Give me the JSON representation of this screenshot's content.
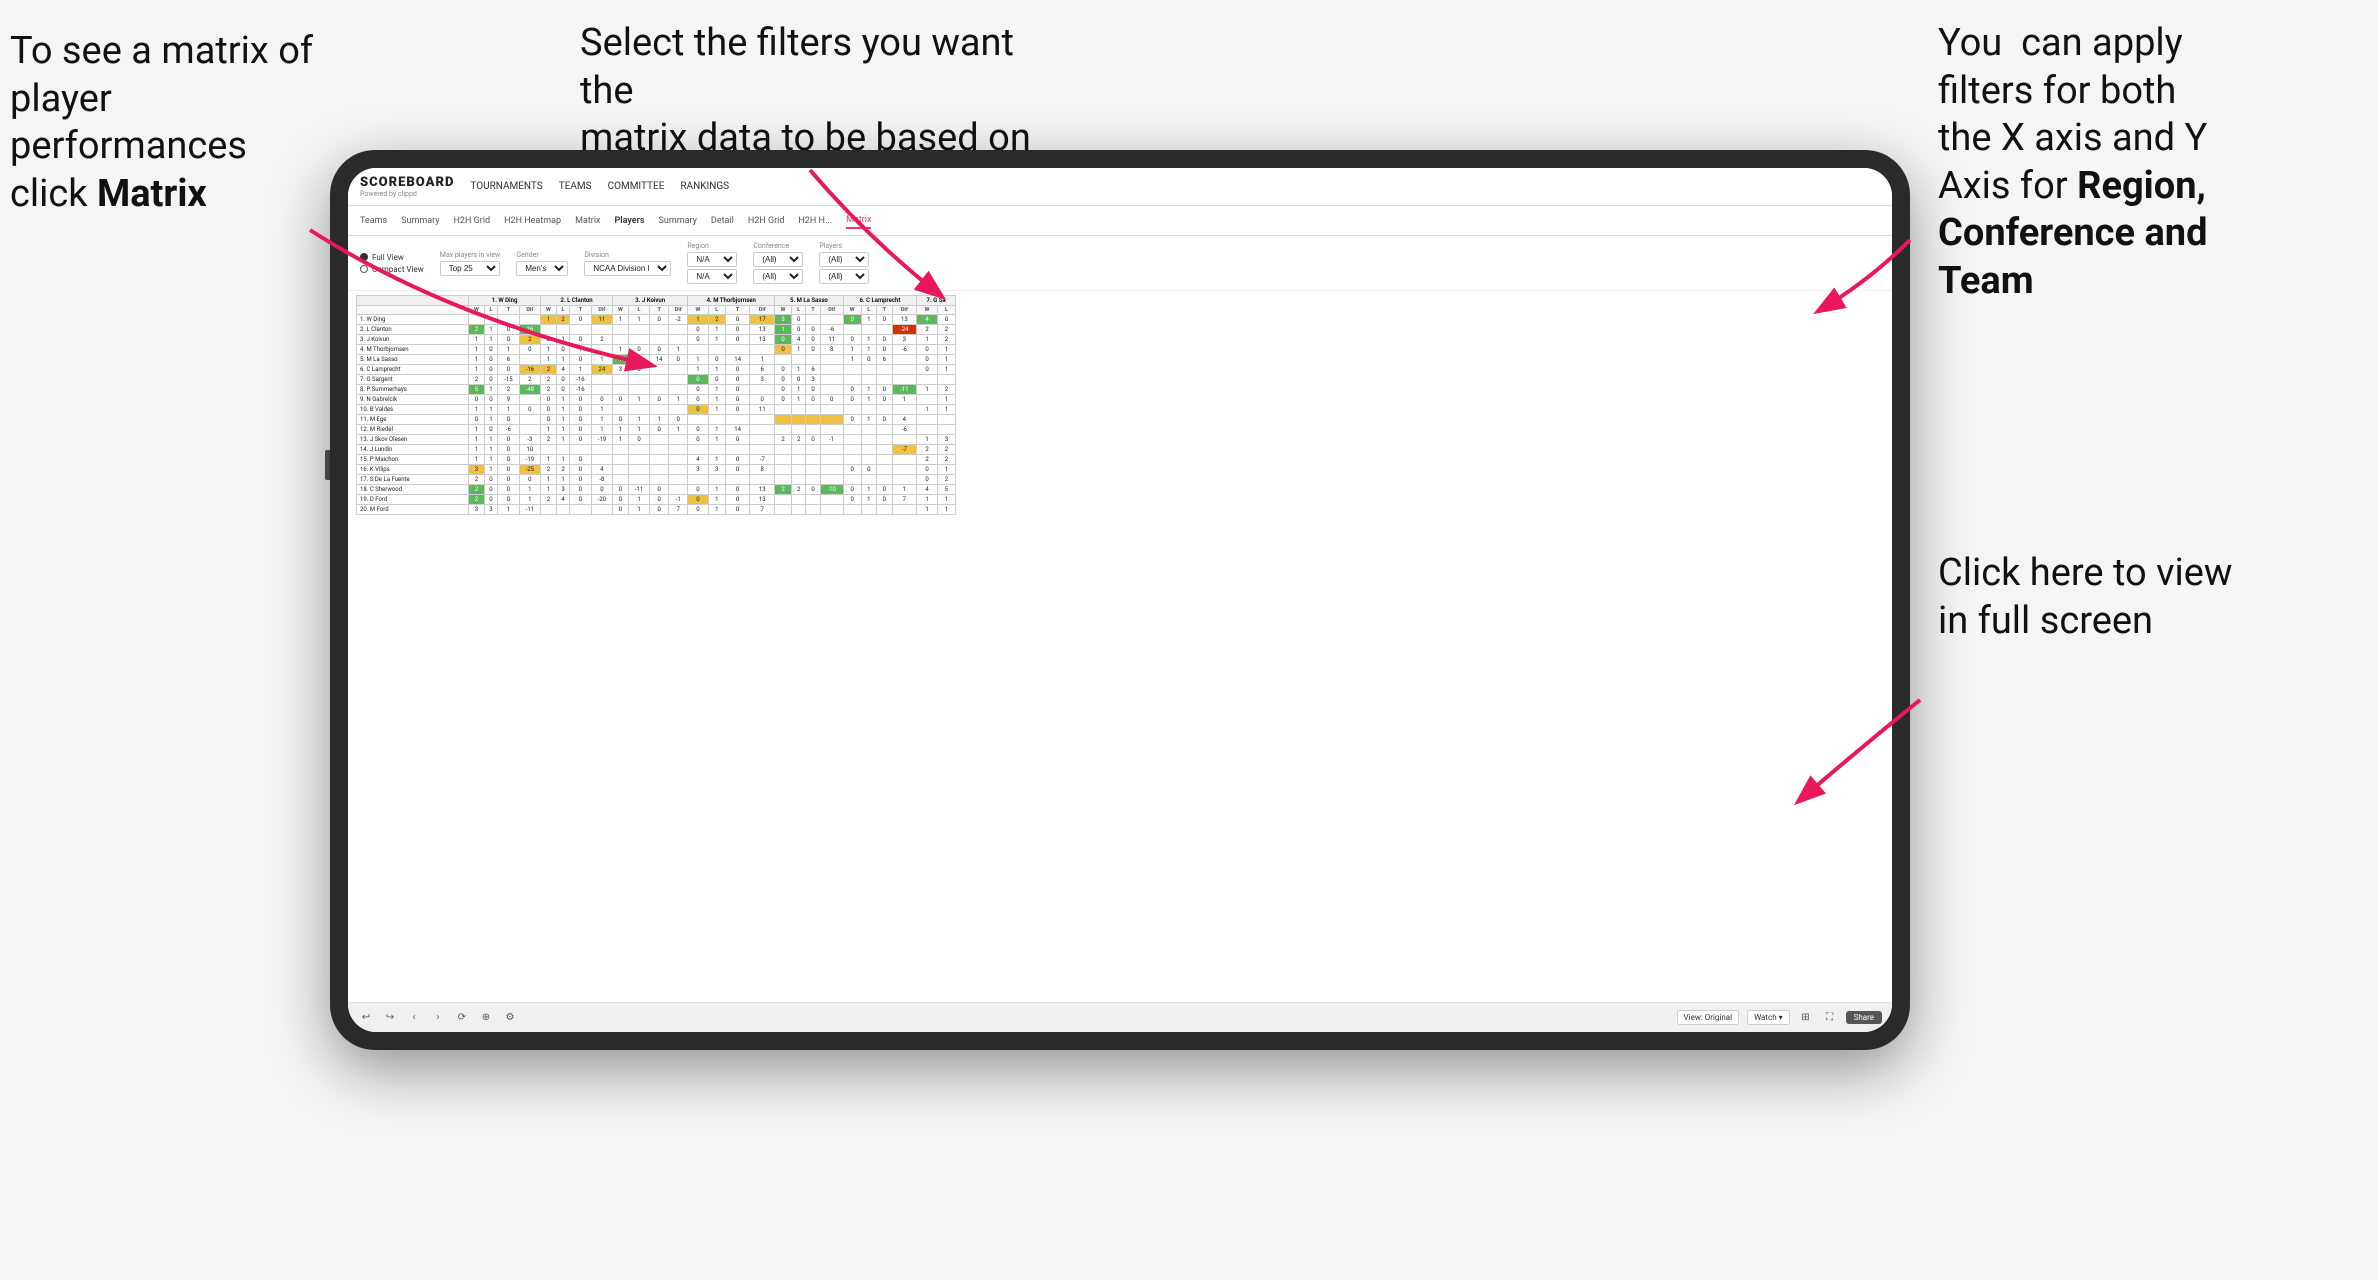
{
  "annotations": {
    "left": {
      "line1": "To see a matrix of",
      "line2": "player performances",
      "line3_pre": "click ",
      "line3_bold": "Matrix"
    },
    "center": {
      "line1": "Select the filters you want the",
      "line2": "matrix data to be based on"
    },
    "right_top": {
      "line1": "You  can apply",
      "line2": "filters for both",
      "line3": "the X axis and Y",
      "line4_pre": "Axis for ",
      "line4_bold": "Region,",
      "line5_bold": "Conference and",
      "line6_bold": "Team"
    },
    "right_bottom": {
      "line1": "Click here to view",
      "line2": "in full screen"
    }
  },
  "nav": {
    "logo": "SCOREBOARD",
    "logo_sub": "Powered by clippd",
    "items": [
      "TOURNAMENTS",
      "TEAMS",
      "COMMITTEE",
      "RANKINGS"
    ]
  },
  "sub_tabs": [
    "Teams",
    "Summary",
    "H2H Grid",
    "H2H Heatmap",
    "Matrix",
    "Players",
    "Summary",
    "Detail",
    "H2H Grid",
    "H2H H...",
    "Matrix"
  ],
  "filters": {
    "view_full": "Full View",
    "view_compact": "Compact View",
    "max_players": "Max players in view",
    "max_val": "Top 25",
    "gender": "Gender",
    "gender_val": "Men's",
    "division": "Division",
    "division_val": "NCAA Division I",
    "region": "Region",
    "region_val1": "N/A",
    "region_val2": "N/A",
    "conference": "Conference",
    "conf_val1": "(All)",
    "conf_val2": "(All)",
    "players": "Players",
    "players_val1": "(All)",
    "players_val2": "(All)"
  },
  "matrix": {
    "col_headers": [
      "1. W Ding",
      "2. L Clanton",
      "3. J Koivun",
      "4. M Thorbjornsen",
      "5. M La Sasso",
      "6. C Lamprecht",
      "7. G Sa"
    ],
    "sub_cols": [
      "W",
      "L",
      "T",
      "Dif"
    ],
    "rows": [
      {
        "name": "1. W Ding",
        "rank": 1
      },
      {
        "name": "2. L Clanton",
        "rank": 2
      },
      {
        "name": "3. J Koivun",
        "rank": 3
      },
      {
        "name": "4. M Thorbjornsen",
        "rank": 4
      },
      {
        "name": "5. M La Sasso",
        "rank": 5
      },
      {
        "name": "6. C Lamprecht",
        "rank": 6
      },
      {
        "name": "7. G Sargent",
        "rank": 7
      },
      {
        "name": "8. P Summerhays",
        "rank": 8
      },
      {
        "name": "9. N Gabrelcik",
        "rank": 9
      },
      {
        "name": "10. B Valdes",
        "rank": 10
      },
      {
        "name": "11. M Ege",
        "rank": 11
      },
      {
        "name": "12. M Riedel",
        "rank": 12
      },
      {
        "name": "13. J Skov Olesen",
        "rank": 13
      },
      {
        "name": "14. J Lundin",
        "rank": 14
      },
      {
        "name": "15. P Maichon",
        "rank": 15
      },
      {
        "name": "16. K Vilips",
        "rank": 16
      },
      {
        "name": "17. S De La Fuente",
        "rank": 17
      },
      {
        "name": "18. C Sherwood",
        "rank": 18
      },
      {
        "name": "19. D Ford",
        "rank": 19
      },
      {
        "name": "20. M Ford",
        "rank": 20
      }
    ]
  },
  "toolbar": {
    "view_label": "View: Original",
    "watch": "Watch",
    "share": "Share"
  }
}
